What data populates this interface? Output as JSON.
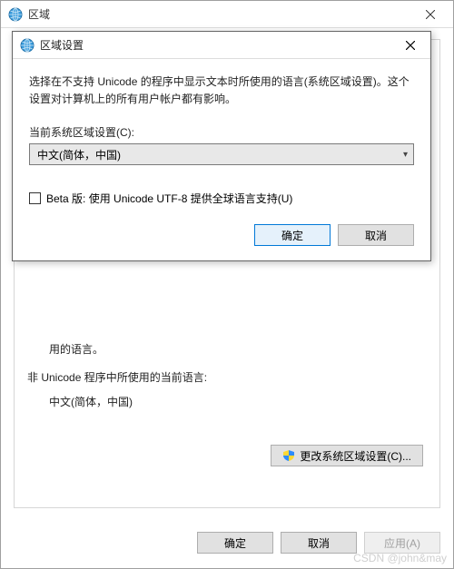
{
  "parent": {
    "title": "区域",
    "body": {
      "text1_suffix": "用的语言。",
      "heading": "非 Unicode 程序中所使用的当前语言:",
      "value": "中文(简体，中国)",
      "change_button": "更改系统区域设置(C)..."
    },
    "footer": {
      "ok": "确定",
      "cancel": "取消",
      "apply": "应用(A)"
    }
  },
  "modal": {
    "title": "区域设置",
    "description": "选择在不支持 Unicode 的程序中显示文本时所使用的语言(系统区域设置)。这个设置对计算机上的所有用户帐户都有影响。",
    "locale_label": "当前系统区域设置(C):",
    "locale_value": "中文(简体，中国)",
    "beta_checkbox": "Beta 版: 使用 Unicode UTF-8 提供全球语言支持(U)",
    "ok": "确定",
    "cancel": "取消"
  },
  "watermark": "CSDN @john&may"
}
